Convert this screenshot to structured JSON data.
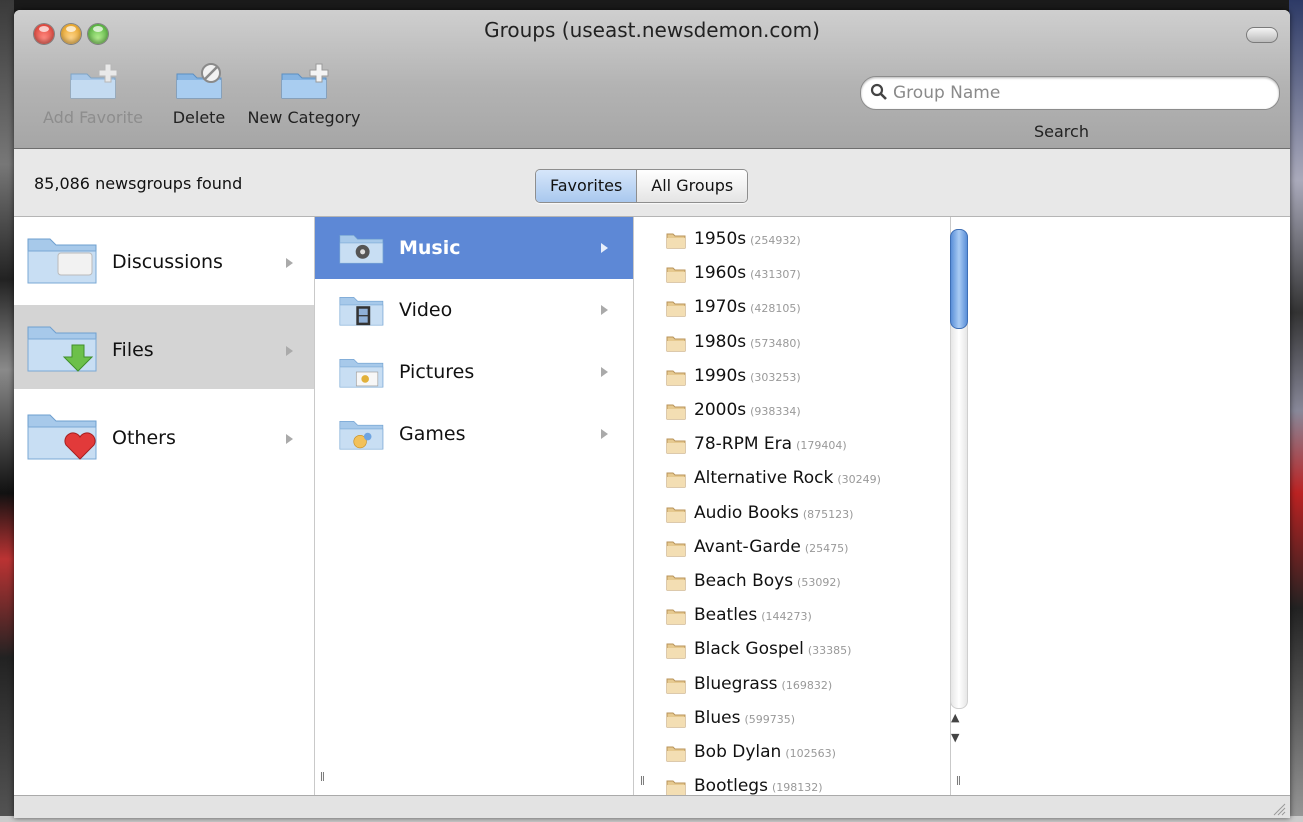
{
  "window": {
    "title": "Groups (useast.newsdemon.com)"
  },
  "toolbar": {
    "add_favorite": "Add Favorite",
    "delete": "Delete",
    "new_category": "New Category",
    "search_placeholder": "Group Name",
    "search_label": "Search"
  },
  "status": {
    "found": "85,086 newsgroups found"
  },
  "segment": {
    "favorites": "Favorites",
    "all_groups": "All Groups"
  },
  "categories": [
    {
      "label": "Discussions",
      "icon": "discussions-folder-icon",
      "selected": false
    },
    {
      "label": "Files",
      "icon": "files-folder-icon",
      "selected": true
    },
    {
      "label": "Others",
      "icon": "others-folder-icon",
      "selected": false
    }
  ],
  "subcategories": [
    {
      "label": "Music",
      "icon": "music-folder-icon",
      "selected": true
    },
    {
      "label": "Video",
      "icon": "video-folder-icon",
      "selected": false
    },
    {
      "label": "Pictures",
      "icon": "pictures-folder-icon",
      "selected": false
    },
    {
      "label": "Games",
      "icon": "games-folder-icon",
      "selected": false
    }
  ],
  "groups": [
    {
      "name": "1950s",
      "count": "(254932)"
    },
    {
      "name": "1960s",
      "count": "(431307)"
    },
    {
      "name": "1970s",
      "count": "(428105)"
    },
    {
      "name": "1980s",
      "count": "(573480)"
    },
    {
      "name": "1990s",
      "count": "(303253)"
    },
    {
      "name": "2000s",
      "count": "(938334)"
    },
    {
      "name": "78-RPM Era",
      "count": "(179404)"
    },
    {
      "name": "Alternative Rock",
      "count": "(30249)"
    },
    {
      "name": "Audio Books",
      "count": "(875123)"
    },
    {
      "name": "Avant-Garde",
      "count": "(25475)"
    },
    {
      "name": "Beach Boys",
      "count": "(53092)"
    },
    {
      "name": "Beatles",
      "count": "(144273)"
    },
    {
      "name": "Black Gospel",
      "count": "(33385)"
    },
    {
      "name": "Bluegrass",
      "count": "(169832)"
    },
    {
      "name": "Blues",
      "count": "(599735)"
    },
    {
      "name": "Bob Dylan",
      "count": "(102563)"
    },
    {
      "name": "Bootlegs",
      "count": "(198132)"
    }
  ],
  "colors": {
    "selection": "#5d88d6",
    "toolbar_top": "#cfcfcf",
    "toolbar_bottom": "#a6a6a6"
  }
}
